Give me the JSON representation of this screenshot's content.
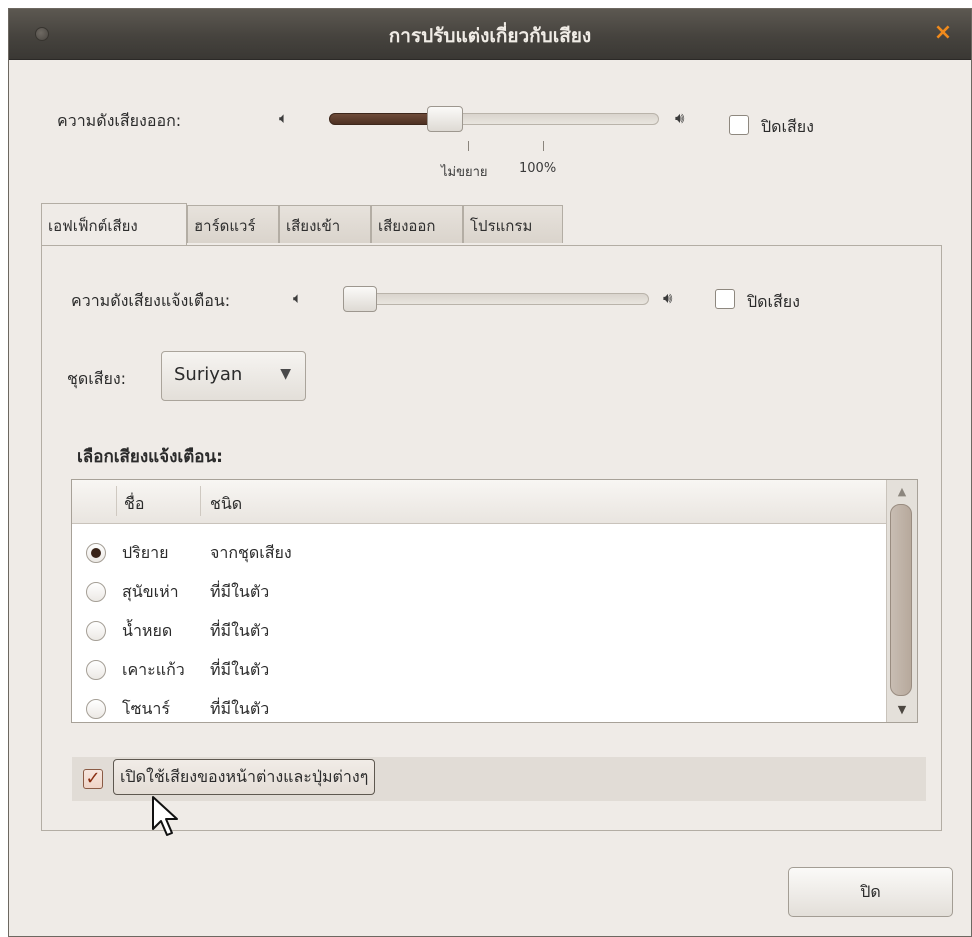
{
  "window": {
    "title": "การปรับแต่งเกี่ยวกับเสียง",
    "close_glyph": "×"
  },
  "output_volume": {
    "label": "ความดังเสียงออก:",
    "level_percent": 25,
    "mark_unamplified": "ไม่ขยาย",
    "mark_100": "100%",
    "mute_label": "ปิดเสียง",
    "muted": false,
    "speaker_low_icon": "speaker-low-icon",
    "speaker_high_icon": "speaker-high-icon"
  },
  "tabs": [
    {
      "label": "เอฟเฟ็กต์เสียง",
      "active": true
    },
    {
      "label": "ฮาร์ดแวร์",
      "active": false
    },
    {
      "label": "เสียงเข้า",
      "active": false
    },
    {
      "label": "เสียงออก",
      "active": false
    },
    {
      "label": "โปรแกรม",
      "active": false
    }
  ],
  "effects": {
    "alert_volume_label": "ความดังเสียงแจ้งเตือน:",
    "alert_level_percent": 5,
    "alert_mute_label": "ปิดเสียง",
    "alert_muted": false,
    "theme_label": "ชุดเสียง:",
    "theme_value": "Suriyan",
    "choose_alert_label": "เลือกเสียงแจ้งเตือน:",
    "columns": [
      "ชื่อ",
      "ชนิด"
    ],
    "rows": [
      {
        "name": "ปริยาย",
        "type": "จากชุดเสียง",
        "selected": true
      },
      {
        "name": "สุนัขเห่า",
        "type": "ที่มีในตัว",
        "selected": false
      },
      {
        "name": "น้ำหยด",
        "type": "ที่มีในตัว",
        "selected": false
      },
      {
        "name": "เคาะแก้ว",
        "type": "ที่มีในตัว",
        "selected": false
      },
      {
        "name": "โซนาร์",
        "type": "ที่มีในตัว",
        "selected": false
      }
    ],
    "window_sounds_label": "เปิดใช้เสียงของหน้าต่างและปุ่มต่างๆ",
    "window_sounds_checked": true
  },
  "footer": {
    "close_label": "ปิด"
  },
  "colors": {
    "accent_close": "#f08a1c",
    "slider_fill": "#5a3a2b"
  }
}
